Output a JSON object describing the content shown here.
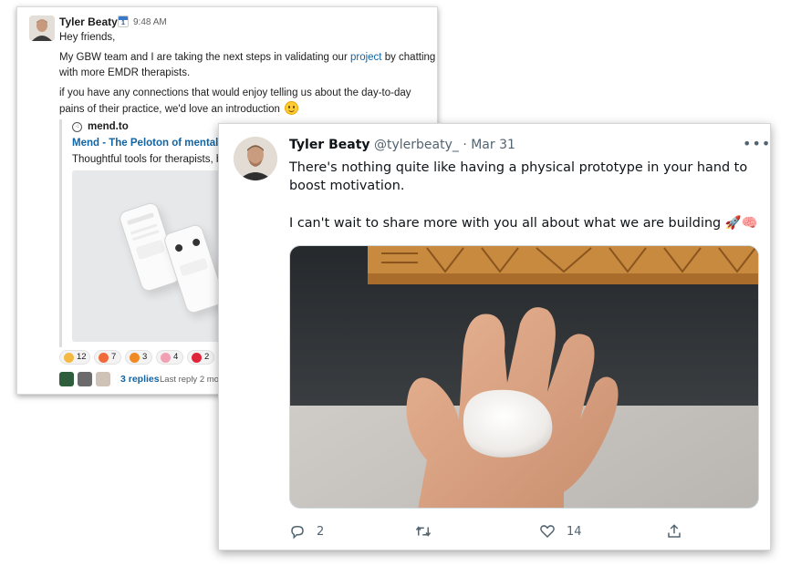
{
  "slack": {
    "author": "Tyler Beaty",
    "status_emoji_num": "1",
    "time": "9:48 AM",
    "greeting": "Hey friends,",
    "para1_before": "My GBW team and I are taking the next steps in validating our ",
    "para1_link": "project",
    "para1_after": " by chatting with more EMDR therapists.",
    "para2": "if you have any connections that would enjoy telling us about the day-to-day pains of their practice, we'd love an introduction",
    "unfurl": {
      "site": "mend.to",
      "favicon": "⁖",
      "title": "Mend - The Peloton of mental he",
      "description": "Thoughtful tools for therapists, b"
    },
    "reactions": [
      {
        "icon": "clap-emoji",
        "count": "12",
        "color": "#f4b942"
      },
      {
        "icon": "boom-emoji",
        "count": "7",
        "color": "#f06a3a"
      },
      {
        "icon": "fire-emoji",
        "count": "3",
        "color": "#f08a24"
      },
      {
        "icon": "brain-emoji",
        "count": "4",
        "color": "#f2a0b4"
      },
      {
        "icon": "heart-emoji",
        "count": "2",
        "color": "#e0243a"
      }
    ],
    "replies_count": "3 replies",
    "last_reply": "Last reply 2 mo"
  },
  "tweet": {
    "name": "Tyler Beaty",
    "handle": "@tylerbeaty_",
    "date": "· Mar 31",
    "more": "•••",
    "line1": "There's nothing quite like having a physical prototype in your hand to boost motivation.",
    "line2": "I can't wait to share more with you all about what we are building",
    "line2_emoji": "🚀🧠",
    "actions": {
      "replies": "2",
      "retweets": "",
      "likes": "14"
    }
  },
  "colors": {
    "slack_link": "#1264a3",
    "twitter_gray": "#536471",
    "photo_wall": "#2f3336",
    "wood_panel": "#c98a3e"
  }
}
